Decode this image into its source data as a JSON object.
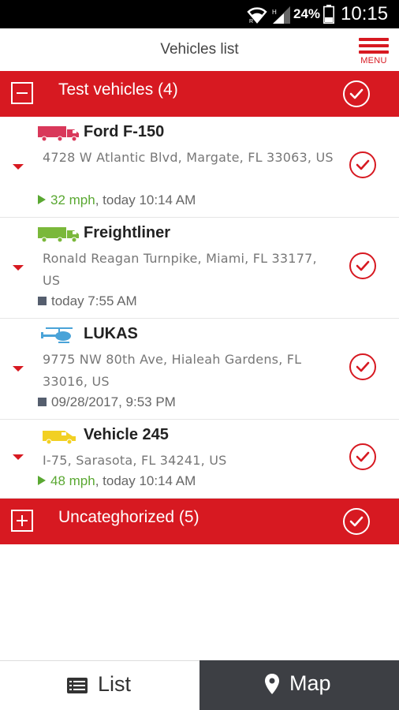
{
  "status_bar": {
    "battery": "24%",
    "time": "10:15"
  },
  "header": {
    "title": "Vehicles list",
    "menu_label": "MENU"
  },
  "groups": [
    {
      "title": "Test vehicles (4)",
      "expanded": true
    },
    {
      "title": "Uncateghorized (5)",
      "expanded": false
    }
  ],
  "vehicles": [
    {
      "name": "Ford F-150",
      "icon": "truck-icon",
      "icon_color": "#d9385a",
      "address": "4728 W Atlantic Blvd, Margate, FL 33063, US",
      "status_type": "moving",
      "speed": "32 mph",
      "time": ", today 10:14 AM"
    },
    {
      "name": "Freightliner",
      "icon": "truck-icon",
      "icon_color": "#7ab83a",
      "address": "Ronald Reagan Turnpike, Miami, FL 33177, US",
      "status_type": "stopped",
      "speed": "",
      "time": "today 7:55 AM"
    },
    {
      "name": "LUKAS",
      "icon": "helicopter-icon",
      "icon_color": "#4aa3d8",
      "address": "9775 NW 80th Ave, Hialeah Gardens, FL 33016, US",
      "status_type": "stopped",
      "speed": "",
      "time": "09/28/2017, 9:53 PM"
    },
    {
      "name": "Vehicle 245",
      "icon": "van-icon",
      "icon_color": "#f2d023",
      "address": "I-75, Sarasota, FL 34241, US",
      "status_type": "moving",
      "speed": "48 mph",
      "time": ", today 10:14 AM"
    }
  ],
  "tabs": {
    "list": "List",
    "map": "Map",
    "active": "list"
  },
  "colors": {
    "accent": "#d71921",
    "speed": "#5aa832",
    "tab_dark": "#3d3f44"
  }
}
